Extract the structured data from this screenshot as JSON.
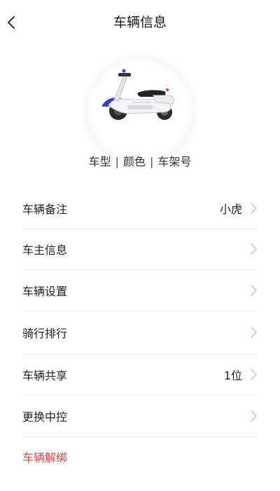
{
  "header": {
    "title": "车辆信息",
    "back_icon": "chevron-left-icon"
  },
  "vehicle": {
    "image": "electric-scooter",
    "meta": {
      "model": "车型",
      "color": "颜色",
      "frame_no": "车架号",
      "separator": "|"
    }
  },
  "menu": [
    {
      "label": "车辆备注",
      "value": "小虎",
      "chevron": true
    },
    {
      "label": "车主信息",
      "value": "",
      "chevron": true
    },
    {
      "label": "车辆设置",
      "value": "",
      "chevron": true
    },
    {
      "label": "骑行排行",
      "value": "",
      "chevron": true
    },
    {
      "label": "车辆共享",
      "value": "1位",
      "chevron": true
    },
    {
      "label": "更换中控",
      "value": "",
      "chevron": true
    },
    {
      "label": "车辆解绑",
      "value": "",
      "chevron": false
    }
  ],
  "colors": {
    "danger": "#e8403a",
    "divider": "#ececec",
    "chevron": "#cccccc",
    "scooter_accent": "#3b3bd6"
  }
}
